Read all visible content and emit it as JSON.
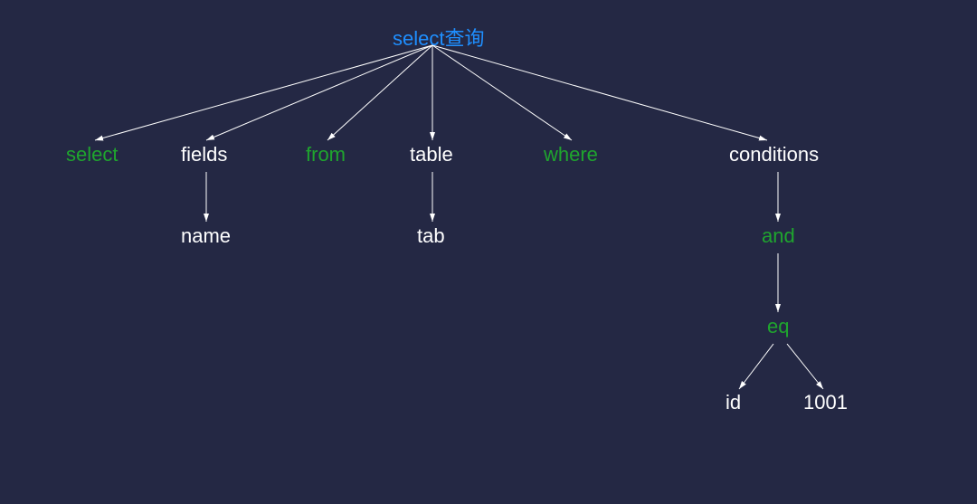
{
  "nodes": {
    "root": "select查询",
    "select": "select",
    "fields": "fields",
    "from": "from",
    "table": "table",
    "where": "where",
    "conditions": "conditions",
    "name": "name",
    "tab": "tab",
    "and": "and",
    "eq": "eq",
    "id": "id",
    "val": "1001"
  },
  "chart_data": {
    "type": "tree",
    "title": "select查询",
    "nodes": [
      {
        "id": "root",
        "label": "select查询",
        "color": "blue"
      },
      {
        "id": "select",
        "label": "select",
        "color": "green"
      },
      {
        "id": "fields",
        "label": "fields",
        "color": "white"
      },
      {
        "id": "from",
        "label": "from",
        "color": "green"
      },
      {
        "id": "table",
        "label": "table",
        "color": "white"
      },
      {
        "id": "where",
        "label": "where",
        "color": "green"
      },
      {
        "id": "conditions",
        "label": "conditions",
        "color": "white"
      },
      {
        "id": "name",
        "label": "name",
        "color": "white"
      },
      {
        "id": "tab",
        "label": "tab",
        "color": "white"
      },
      {
        "id": "and",
        "label": "and",
        "color": "green"
      },
      {
        "id": "eq",
        "label": "eq",
        "color": "green"
      },
      {
        "id": "idleaf",
        "label": "id",
        "color": "white"
      },
      {
        "id": "val",
        "label": "1001",
        "color": "white"
      }
    ],
    "edges": [
      {
        "from": "root",
        "to": "select"
      },
      {
        "from": "root",
        "to": "fields"
      },
      {
        "from": "root",
        "to": "from"
      },
      {
        "from": "root",
        "to": "table"
      },
      {
        "from": "root",
        "to": "where"
      },
      {
        "from": "root",
        "to": "conditions"
      },
      {
        "from": "fields",
        "to": "name"
      },
      {
        "from": "table",
        "to": "tab"
      },
      {
        "from": "conditions",
        "to": "and"
      },
      {
        "from": "and",
        "to": "eq"
      },
      {
        "from": "eq",
        "to": "idleaf"
      },
      {
        "from": "eq",
        "to": "val"
      }
    ]
  }
}
